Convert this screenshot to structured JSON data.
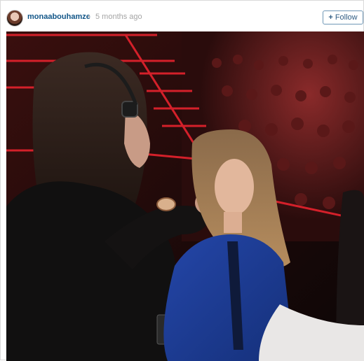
{
  "post": {
    "username": "monaabouhamze",
    "separator": "•",
    "timestamp": "5 months ago",
    "follow_label": "Follow",
    "follow_icon": "plus-icon"
  },
  "photo": {
    "icon": "photo-icon",
    "colors": {
      "stage_red": "#d4202a",
      "dress_blue": "#1f3f9a",
      "backdrop": "#1a0b0b"
    }
  }
}
